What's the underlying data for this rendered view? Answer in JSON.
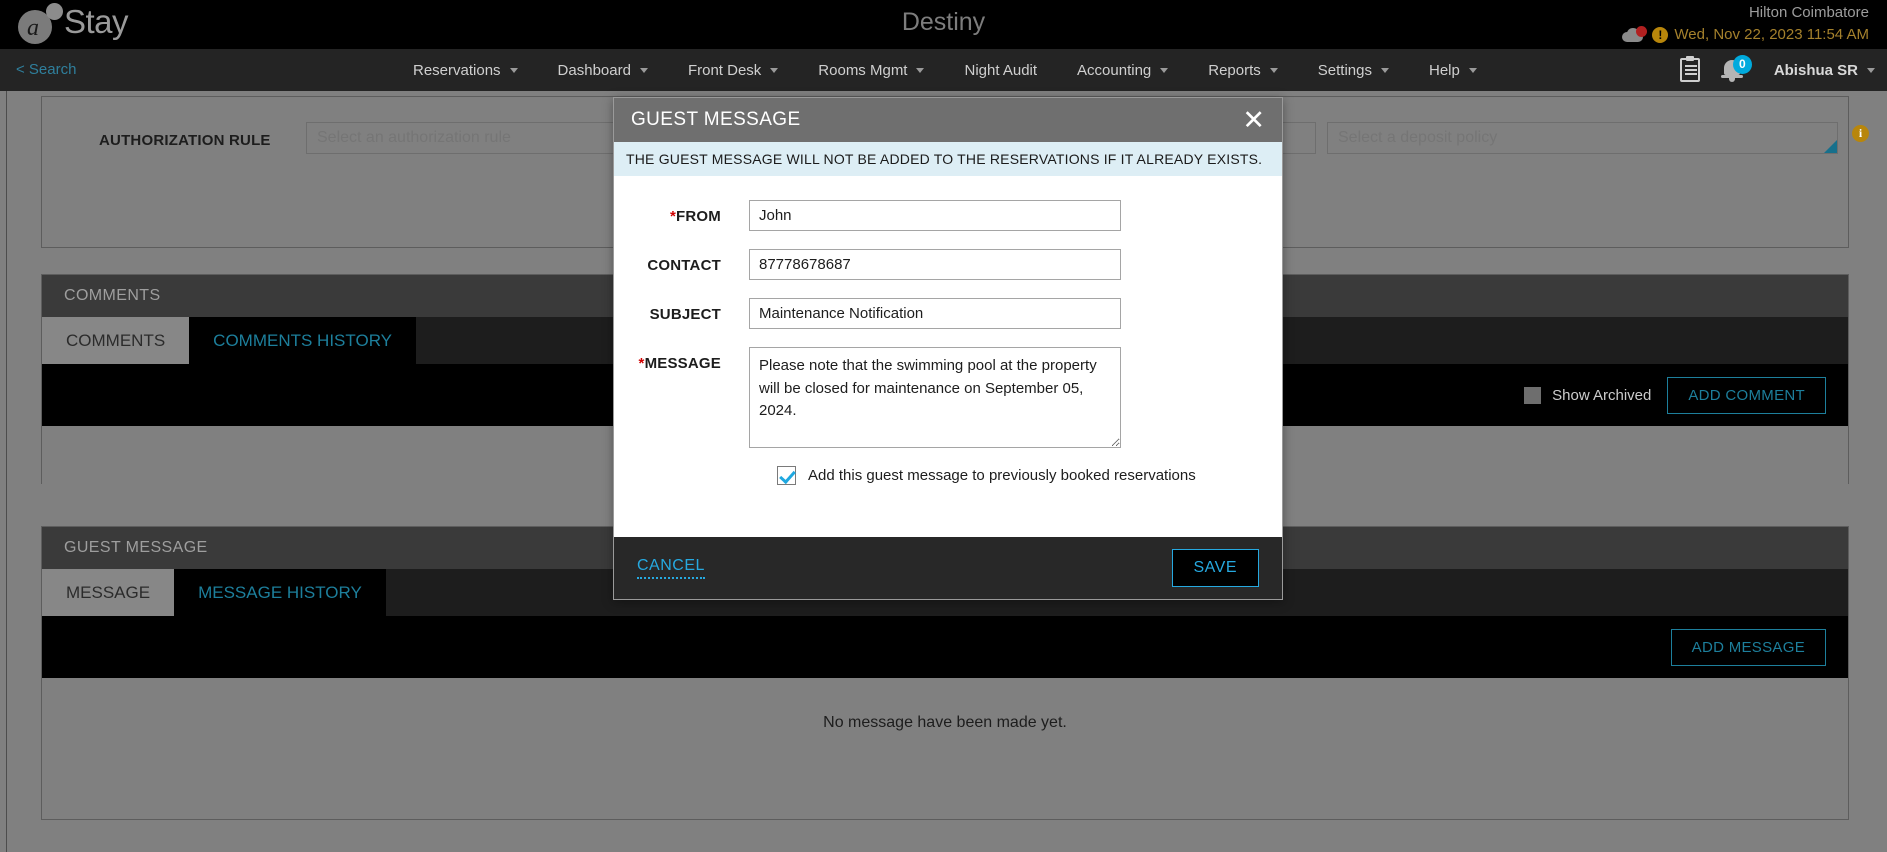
{
  "brand": {
    "logo_text": "Stay",
    "logo_letter": "a"
  },
  "header": {
    "app_title": "Destiny",
    "property_name": "Hilton Coimbatore",
    "datetime": "Wed, Nov 22, 2023 11:54 AM",
    "cloud_icon": "cloud-sync-icon",
    "warning_icon": "warning-icon"
  },
  "nav": {
    "search_label": "< Search",
    "items": [
      {
        "label": "Reservations",
        "has_caret": true
      },
      {
        "label": "Dashboard",
        "has_caret": true
      },
      {
        "label": "Front Desk",
        "has_caret": true
      },
      {
        "label": "Rooms Mgmt",
        "has_caret": true
      },
      {
        "label": "Night Audit",
        "has_caret": false
      },
      {
        "label": "Accounting",
        "has_caret": true
      },
      {
        "label": "Reports",
        "has_caret": true
      },
      {
        "label": "Settings",
        "has_caret": true
      },
      {
        "label": "Help",
        "has_caret": true
      }
    ],
    "clipboard_icon": "clipboard-icon",
    "bell_icon": "bell-icon",
    "notification_count": "0",
    "user_name": "Abishua SR"
  },
  "authorization": {
    "label": "AUTHORIZATION RULE",
    "rule_placeholder": "Select an authorization rule",
    "rule_value": "",
    "deposit_placeholder": "Select a deposit policy",
    "deposit_value": "",
    "info_icon": "info-icon",
    "info_glyph": "i"
  },
  "comments_section": {
    "header": "COMMENTS",
    "tabs": [
      {
        "label": "COMMENTS",
        "active": true
      },
      {
        "label": "COMMENTS HISTORY",
        "active": false
      }
    ],
    "show_archived_label": "Show Archived",
    "show_archived_checked": false,
    "add_button": "ADD COMMENT"
  },
  "guest_message_section": {
    "header": "GUEST MESSAGE",
    "tabs": [
      {
        "label": "MESSAGE",
        "active": true
      },
      {
        "label": "MESSAGE HISTORY",
        "active": false
      }
    ],
    "add_button": "ADD MESSAGE",
    "empty_text": "No message have been made yet."
  },
  "modal": {
    "title": "GUEST MESSAGE",
    "close_icon": "close-icon",
    "close_glyph": "✕",
    "notice": "THE GUEST MESSAGE WILL NOT BE ADDED TO THE RESERVATIONS IF IT ALREADY EXISTS.",
    "fields": {
      "from_label": "FROM",
      "from_required": "*",
      "from_value": "John",
      "contact_label": "CONTACT",
      "contact_value": "87778678687",
      "subject_label": "SUBJECT",
      "subject_value": "Maintenance Notification",
      "message_label": "MESSAGE",
      "message_required": "*",
      "message_value": "Please note that the swimming pool at the property will be closed for maintenance on September 05, 2024."
    },
    "checkbox_label": "Add this guest message to previously booked reservations",
    "checkbox_checked": true,
    "cancel_label": "CANCEL",
    "save_label": "SAVE"
  },
  "colors": {
    "accent_blue": "#26a9e0",
    "tab_link": "#1d7f9c",
    "required_red": "#d00000",
    "notice_bg": "#ddeef5",
    "warning_amber": "#b8860b",
    "page_bg": "#808080"
  }
}
